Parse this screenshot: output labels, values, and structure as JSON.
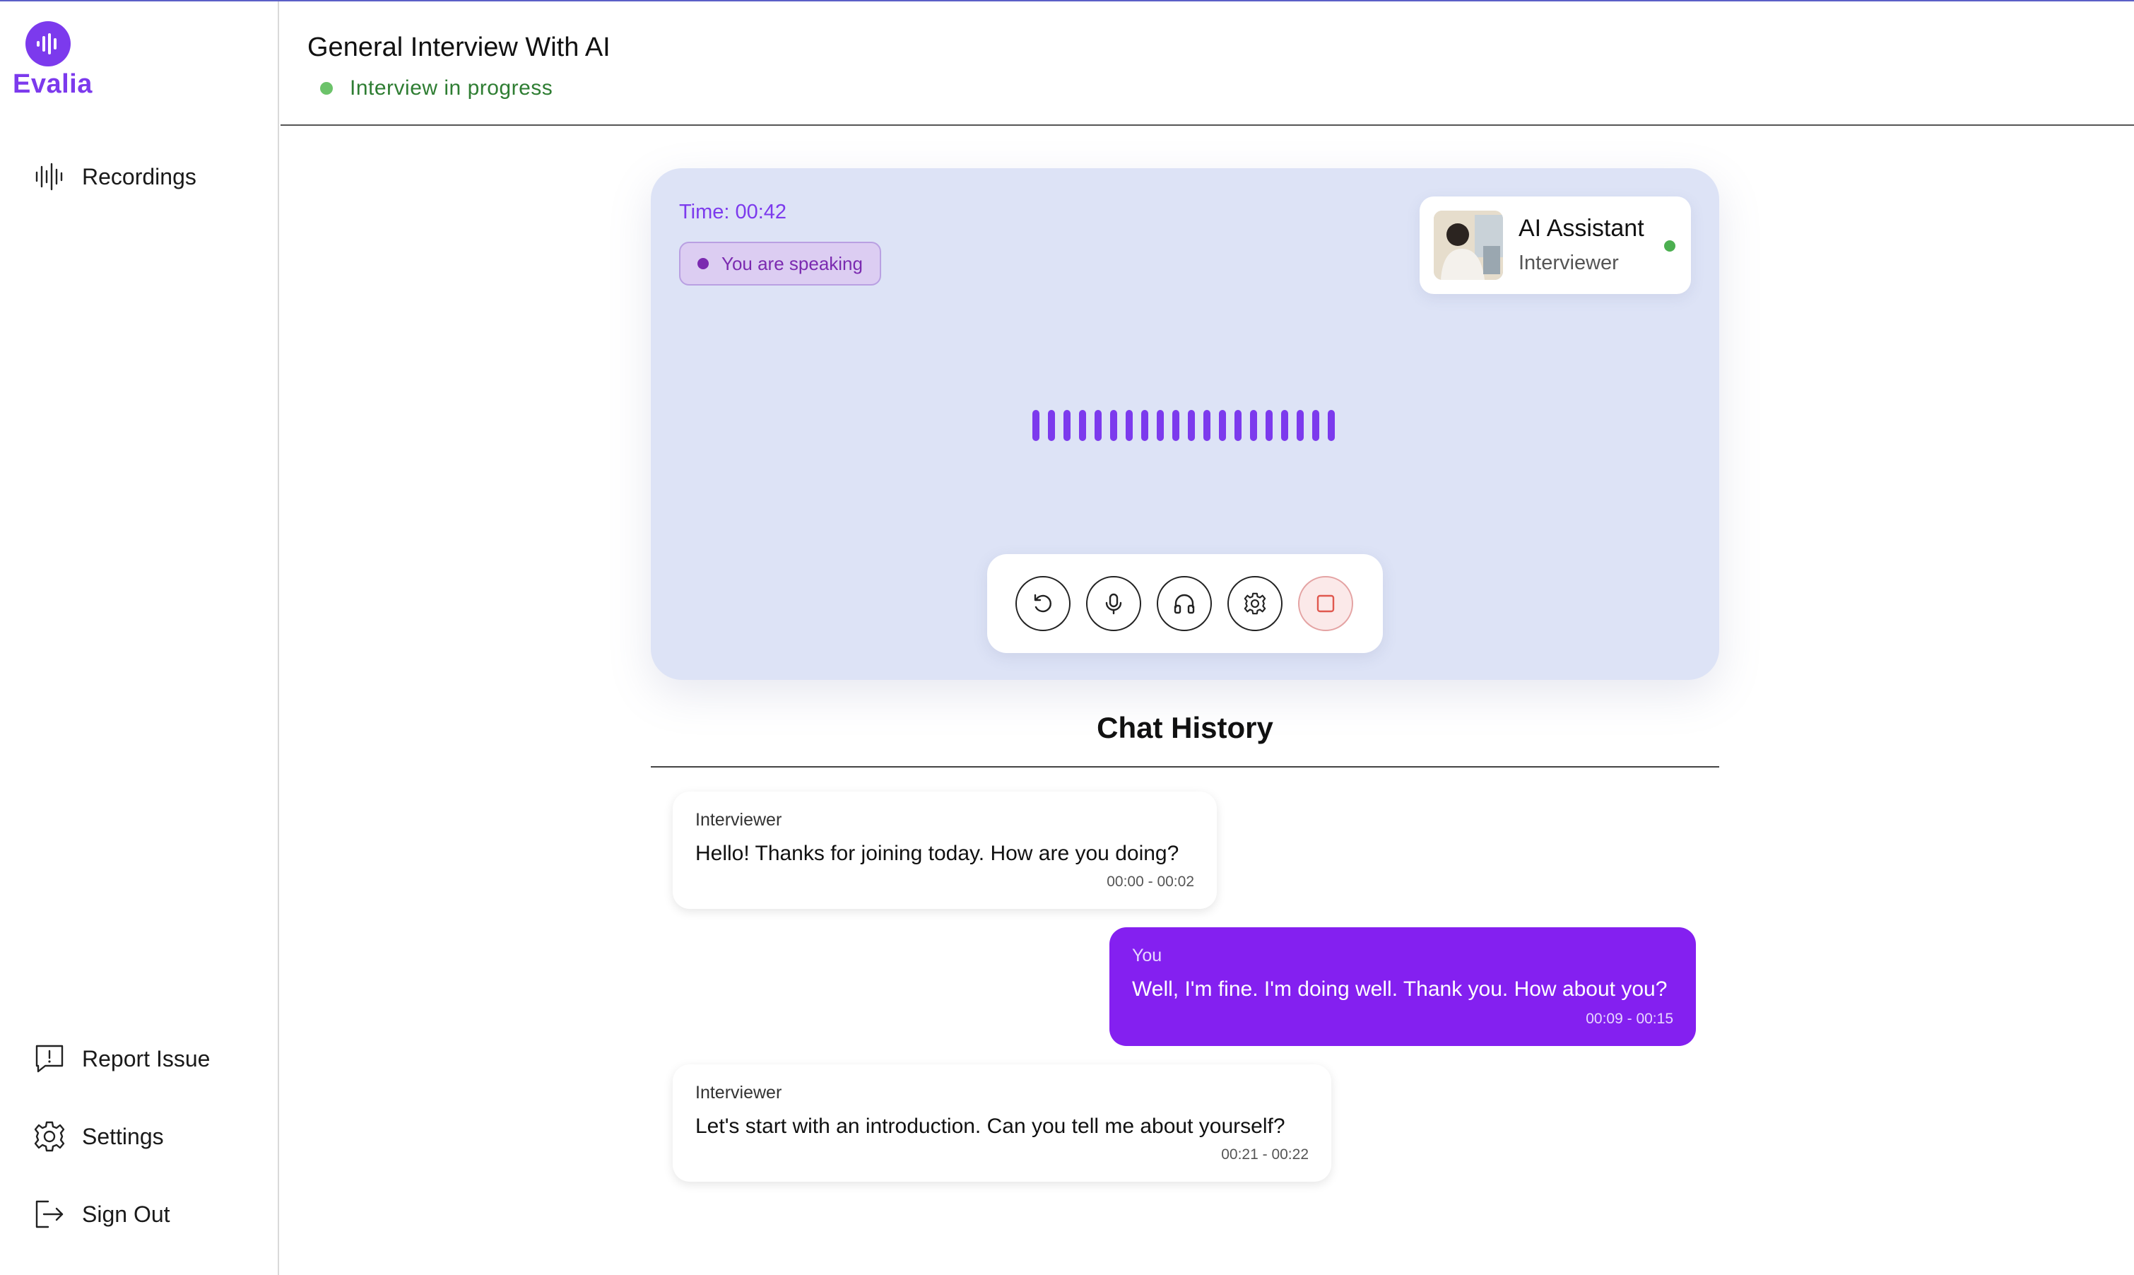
{
  "brand": {
    "name": "Evalia",
    "accent": "#7c3aed"
  },
  "sidebar": {
    "items": [
      {
        "label": "Recordings",
        "icon": "waveform-icon"
      },
      {
        "label": "Report Issue",
        "icon": "report-issue-icon"
      },
      {
        "label": "Settings",
        "icon": "gear-icon"
      },
      {
        "label": "Sign Out",
        "icon": "sign-out-icon"
      }
    ]
  },
  "header": {
    "title": "General Interview With AI",
    "status": "Interview in progress",
    "status_color": "#2e7d32"
  },
  "call": {
    "timer": "Time: 00:42",
    "speaking_label": "You are speaking",
    "assistant": {
      "name": "AI Assistant",
      "role": "Interviewer",
      "online": true
    },
    "controls": [
      "restart-icon",
      "microphone-icon",
      "headphones-icon",
      "gear-icon",
      "stop-icon"
    ]
  },
  "chat": {
    "title": "Chat History",
    "messages": [
      {
        "speaker": "Interviewer",
        "text": "Hello! Thanks for joining today. How are you doing?",
        "time": "00:00 - 00:02"
      },
      {
        "speaker": "You",
        "text": "Well, I'm fine. I'm doing well. Thank you. How about you?",
        "time": "00:09 - 00:15"
      },
      {
        "speaker": "Interviewer",
        "text": "Let's start with an introduction. Can you tell me about yourself?",
        "time": "00:21 - 00:22"
      }
    ]
  }
}
